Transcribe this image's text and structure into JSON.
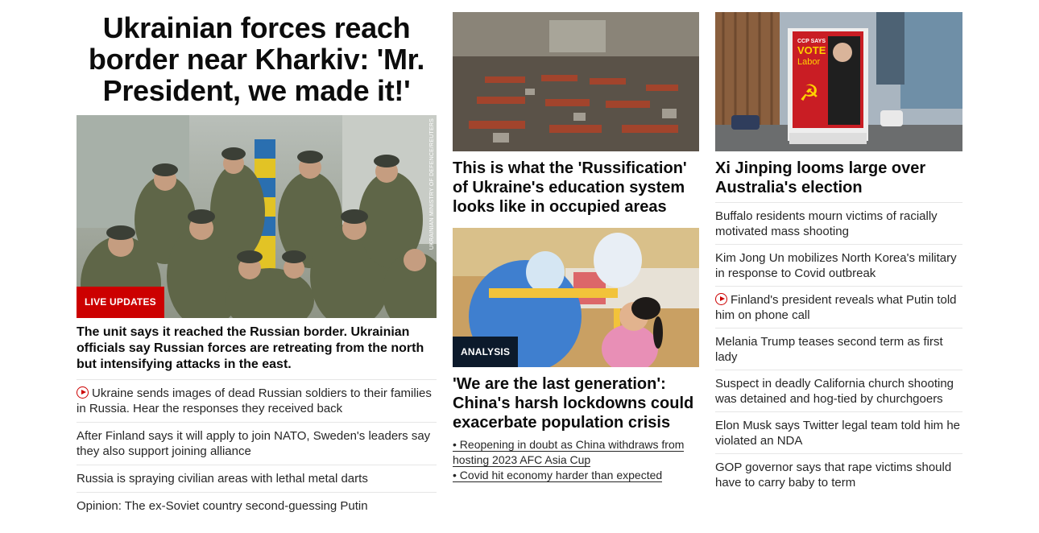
{
  "main": {
    "headline": "Ukrainian forces reach border near Kharkiv: 'Mr. President, we made it!'",
    "badge": "LIVE UPDATES",
    "photo_credit": "UKRAINIAN MINISTRY OF DEFENCE/REUTERS",
    "lede": "The unit says it reached the Russian border. Ukrainian officials say Russian forces are retreating from the north but intensifying attacks in the east.",
    "items": [
      {
        "label": "Ukraine sends images of dead Russian soldiers to their families in Russia. Hear the responses they received back",
        "video": true
      },
      {
        "label": "After Finland says it will apply to join NATO, Sweden's leaders say they also support joining alliance",
        "video": false
      },
      {
        "label": "Russia is spraying civilian areas with lethal metal darts",
        "video": false
      },
      {
        "label": "Opinion: The ex-Soviet country second-guessing Putin",
        "video": false
      }
    ]
  },
  "middle": {
    "story1": {
      "headline": "This is what the 'Russification' of Ukraine's education system looks like in occupied areas"
    },
    "story2": {
      "badge": "ANALYSIS",
      "headline": "'We are the last generation': China's harsh lockdowns could exacerbate population crisis",
      "links": [
        "• Reopening in doubt as China withdraws from hosting 2023 AFC Asia Cup",
        "• Covid hit economy harder than expected"
      ]
    }
  },
  "right": {
    "headline": "Xi Jinping looms large over Australia's election",
    "poster_text": {
      "line1": "CCP SAYS",
      "line2": "VOTE",
      "line3": "Labor"
    },
    "items": [
      {
        "label": "Buffalo residents mourn victims of racially motivated mass shooting",
        "video": false
      },
      {
        "label": "Kim Jong Un mobilizes North Korea's military in response to Covid outbreak",
        "video": false
      },
      {
        "label": "Finland's president reveals what Putin told him on phone call",
        "video": true
      },
      {
        "label": "Melania Trump teases second term as first lady",
        "video": false
      },
      {
        "label": "Suspect in deadly California church shooting was detained and hog-tied by churchgoers",
        "video": false
      },
      {
        "label": "Elon Musk says Twitter legal team told him he violated an NDA",
        "video": false
      },
      {
        "label": "GOP governor says that rape victims should have to carry baby to term",
        "video": false
      }
    ]
  },
  "colors": {
    "live": "#cc0000",
    "analysis": "#0c1a2b",
    "divider": "#e6e6e6"
  }
}
